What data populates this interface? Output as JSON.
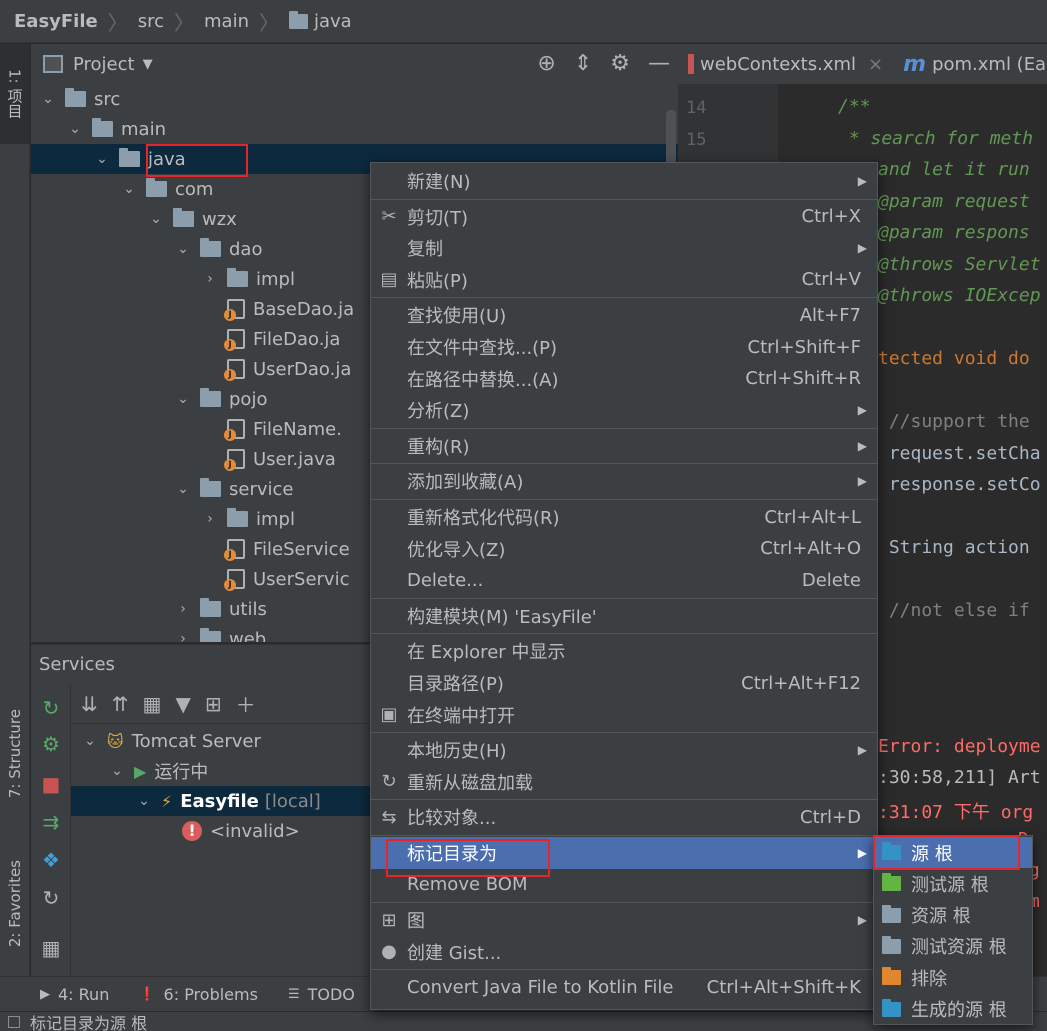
{
  "breadcrumb": [
    "EasyFile",
    "src",
    "main",
    "java"
  ],
  "left_strip": {
    "project_tab": "1: 项目",
    "structure_tab": "7: Structure",
    "favorites_tab": "2: Favorites"
  },
  "project_panel": {
    "title": "Project"
  },
  "tree": [
    {
      "label": "src",
      "depth": 1,
      "expanded": true,
      "kind": "folder"
    },
    {
      "label": "main",
      "depth": 2,
      "expanded": true,
      "kind": "folder"
    },
    {
      "label": "java",
      "depth": 3,
      "expanded": true,
      "kind": "folder",
      "selected": true
    },
    {
      "label": "com",
      "depth": 4,
      "expanded": true,
      "kind": "folder"
    },
    {
      "label": "wzx",
      "depth": 5,
      "expanded": true,
      "kind": "folder"
    },
    {
      "label": "dao",
      "depth": 6,
      "expanded": true,
      "kind": "folder"
    },
    {
      "label": "impl",
      "depth": 7,
      "expanded": false,
      "kind": "folder"
    },
    {
      "label": "BaseDao.ja",
      "depth": 7,
      "kind": "java"
    },
    {
      "label": "FileDao.ja",
      "depth": 7,
      "kind": "java"
    },
    {
      "label": "UserDao.ja",
      "depth": 7,
      "kind": "java"
    },
    {
      "label": "pojo",
      "depth": 6,
      "expanded": true,
      "kind": "folder"
    },
    {
      "label": "FileName.",
      "depth": 7,
      "kind": "java"
    },
    {
      "label": "User.java",
      "depth": 7,
      "kind": "java"
    },
    {
      "label": "service",
      "depth": 6,
      "expanded": true,
      "kind": "folder"
    },
    {
      "label": "impl",
      "depth": 7,
      "expanded": false,
      "kind": "folder"
    },
    {
      "label": "FileService",
      "depth": 7,
      "kind": "java"
    },
    {
      "label": "UserServic",
      "depth": 7,
      "kind": "java"
    },
    {
      "label": "utils",
      "depth": 6,
      "expanded": false,
      "kind": "folder"
    },
    {
      "label": "web",
      "depth": 6,
      "expanded": false,
      "kind": "folder"
    }
  ],
  "editor_tabs": [
    {
      "label": "webContexts.xml",
      "close": "×"
    },
    {
      "label": "pom.xml (Easyf",
      "icon": "m"
    }
  ],
  "code_lines": [
    {
      "ln": "14",
      "text": "/**",
      "color": "#629755",
      "italic": true
    },
    {
      "ln": "15",
      "text": " * search for meth",
      "color": "#629755",
      "italic": true
    },
    {
      "ln": "",
      "text": "and let it run",
      "color": "#629755",
      "italic": true
    },
    {
      "ln": "",
      "text": "@param request",
      "color": "#629755",
      "italic": true
    },
    {
      "ln": "",
      "text": "@param respons",
      "color": "#629755",
      "italic": true
    },
    {
      "ln": "",
      "text": "@throws Servlet",
      "color": "#629755",
      "italic": true
    },
    {
      "ln": "",
      "text": "@throws IOExcep",
      "color": "#629755",
      "italic": true
    },
    {
      "ln": "",
      "text": "",
      "color": "#a9b7c6",
      "italic": false
    },
    {
      "ln": "",
      "text": "tected void do",
      "color": "#cc7832",
      "italic": false
    },
    {
      "ln": "",
      "text": "",
      "color": "#a9b7c6",
      "italic": false
    },
    {
      "ln": "",
      "text": " //support the",
      "color": "#808080",
      "italic": false
    },
    {
      "ln": "",
      "text": " request.setCha",
      "color": "#a9b7c6",
      "italic": false
    },
    {
      "ln": "",
      "text": " response.setCo",
      "color": "#a9b7c6",
      "italic": false
    },
    {
      "ln": "",
      "text": "",
      "color": "#a9b7c6",
      "italic": false
    },
    {
      "ln": "",
      "text": " String action",
      "color": "#a9b7c6",
      "italic": false
    },
    {
      "ln": "",
      "text": "",
      "color": "#a9b7c6",
      "italic": false
    },
    {
      "ln": "",
      "text": " //not else if",
      "color": "#808080",
      "italic": false
    }
  ],
  "services": {
    "title": "Services",
    "tree": [
      {
        "label": "Tomcat Server",
        "depth": 1
      },
      {
        "label": "运行中",
        "depth": 2
      },
      {
        "label": "Easyfile",
        "suffix": "[local]",
        "depth": 3,
        "selected": true
      },
      {
        "label": "<invalid>",
        "depth": 4
      }
    ]
  },
  "console_lines": [
    {
      "text": "Error: deployme",
      "color": "#ff6b68"
    },
    {
      "text": ":30:58,211] Art",
      "color": "#bbbbbb"
    },
    {
      "text": ":31:07 下午 org",
      "color": "#ff6b68"
    },
    {
      "text": "D",
      "color": "#ff6b68"
    },
    {
      "text": "rg",
      "color": "#ff6b68"
    },
    {
      "text": "am",
      "color": "#ff6b68"
    }
  ],
  "context_menu": [
    {
      "label": "新建(N)",
      "submenu": true
    },
    {
      "sep": true
    },
    {
      "label": "剪切(T)",
      "shortcut": "Ctrl+X",
      "icon": "✂"
    },
    {
      "label": "复制",
      "submenu": true
    },
    {
      "label": "粘贴(P)",
      "shortcut": "Ctrl+V",
      "icon": "📋"
    },
    {
      "sep": true
    },
    {
      "label": "查找使用(U)",
      "shortcut": "Alt+F7"
    },
    {
      "label": "在文件中查找...(P)",
      "shortcut": "Ctrl+Shift+F"
    },
    {
      "label": "在路径中替换...(A)",
      "shortcut": "Ctrl+Shift+R"
    },
    {
      "label": "分析(Z)",
      "submenu": true
    },
    {
      "sep": true
    },
    {
      "label": "重构(R)",
      "submenu": true
    },
    {
      "sep": true
    },
    {
      "label": "添加到收藏(A)",
      "submenu": true
    },
    {
      "sep": true
    },
    {
      "label": "重新格式化代码(R)",
      "shortcut": "Ctrl+Alt+L"
    },
    {
      "label": "优化导入(Z)",
      "shortcut": "Ctrl+Alt+O"
    },
    {
      "label": "Delete...",
      "shortcut": "Delete"
    },
    {
      "sep": true
    },
    {
      "label": "构建模块(M) 'EasyFile'"
    },
    {
      "sep": true
    },
    {
      "label": "在 Explorer 中显示"
    },
    {
      "label": "目录路径(P)",
      "shortcut": "Ctrl+Alt+F12"
    },
    {
      "label": "在终端中打开",
      "icon": "▣"
    },
    {
      "sep": true
    },
    {
      "label": "本地历史(H)",
      "submenu": true
    },
    {
      "label": "重新从磁盘加载",
      "icon": "↻"
    },
    {
      "sep": true
    },
    {
      "label": "比较对象...",
      "shortcut": "Ctrl+D",
      "icon": "⇆"
    },
    {
      "sep": true
    },
    {
      "label": "标记目录为",
      "submenu": true,
      "active": true
    },
    {
      "label": "Remove BOM"
    },
    {
      "sep": true
    },
    {
      "label": "图",
      "submenu": true,
      "icon": "⊞"
    },
    {
      "label": "创建 Gist...",
      "icon": "●"
    },
    {
      "sep": true
    },
    {
      "label": "Convert Java File to Kotlin File",
      "shortcut": "Ctrl+Alt+Shift+K"
    }
  ],
  "submenu": [
    {
      "label": "源 根",
      "color": "blue",
      "active": true
    },
    {
      "label": "测试源 根",
      "color": "green"
    },
    {
      "label": "资源 根",
      "color": "res"
    },
    {
      "label": "测试资源 根",
      "color": "testres"
    },
    {
      "label": "排除",
      "color": "orange"
    },
    {
      "label": "生成的源 根",
      "color": "gen"
    }
  ],
  "bottom_bar": [
    {
      "label": "4: Run",
      "icon": "▶"
    },
    {
      "label": "6: Problems",
      "icon": "❗"
    },
    {
      "label": "TODO",
      "icon": "☰"
    }
  ],
  "status_bar": {
    "text": "标记目录为源 根"
  }
}
